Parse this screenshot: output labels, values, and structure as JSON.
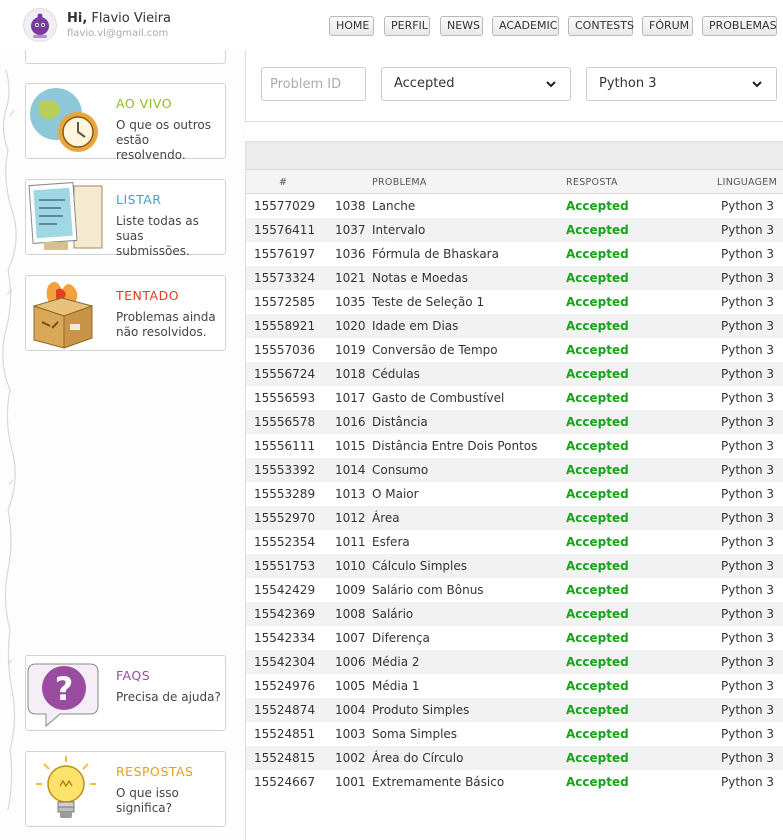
{
  "header": {
    "greeting_prefix": "Hi,",
    "user_name": "Flavio Vieira",
    "email": "flavio.vl@gmail.com",
    "nav": [
      "HOME",
      "PERFIL",
      "NEWS",
      "ACADEMIC",
      "CONTESTS",
      "FÓRUM",
      "PROBLEMAS"
    ]
  },
  "sidebar": {
    "cards": [
      {
        "title": "AO VIVO",
        "description": "O que os outros estão resolvendo.",
        "color": "#8dbd1d"
      },
      {
        "title": "LISTAR",
        "description": "Liste todas as suas submissões.",
        "color": "#3ea3c7"
      },
      {
        "title": "TENTADO",
        "description": "Problemas ainda não resolvidos.",
        "color": "#e0401d"
      },
      {
        "title": "FAQS",
        "description": "Precisa de ajuda?",
        "color": "#9a4da0"
      },
      {
        "title": "RESPOSTAS",
        "description": "O que isso significa?",
        "color": "#e8a012"
      }
    ]
  },
  "filters": {
    "problem_id_placeholder": "Problem ID",
    "answer_selected": "Accepted",
    "language_selected": "Python 3"
  },
  "table": {
    "headers": [
      "#",
      "PROBLEMA",
      "RESPOSTA",
      "LINGUAGEM"
    ],
    "rows": [
      {
        "id": "15577029",
        "pid": "1038",
        "problem": "Lanche",
        "answer": "Accepted",
        "lang": "Python 3"
      },
      {
        "id": "15576411",
        "pid": "1037",
        "problem": "Intervalo",
        "answer": "Accepted",
        "lang": "Python 3"
      },
      {
        "id": "15576197",
        "pid": "1036",
        "problem": "Fórmula de Bhaskara",
        "answer": "Accepted",
        "lang": "Python 3"
      },
      {
        "id": "15573324",
        "pid": "1021",
        "problem": "Notas e Moedas",
        "answer": "Accepted",
        "lang": "Python 3"
      },
      {
        "id": "15572585",
        "pid": "1035",
        "problem": "Teste de Seleção 1",
        "answer": "Accepted",
        "lang": "Python 3"
      },
      {
        "id": "15558921",
        "pid": "1020",
        "problem": "Idade em Dias",
        "answer": "Accepted",
        "lang": "Python 3"
      },
      {
        "id": "15557036",
        "pid": "1019",
        "problem": "Conversão de Tempo",
        "answer": "Accepted",
        "lang": "Python 3"
      },
      {
        "id": "15556724",
        "pid": "1018",
        "problem": "Cédulas",
        "answer": "Accepted",
        "lang": "Python 3"
      },
      {
        "id": "15556593",
        "pid": "1017",
        "problem": "Gasto de Combustível",
        "answer": "Accepted",
        "lang": "Python 3"
      },
      {
        "id": "15556578",
        "pid": "1016",
        "problem": "Distância",
        "answer": "Accepted",
        "lang": "Python 3"
      },
      {
        "id": "15556111",
        "pid": "1015",
        "problem": "Distância Entre Dois Pontos",
        "answer": "Accepted",
        "lang": "Python 3"
      },
      {
        "id": "15553392",
        "pid": "1014",
        "problem": "Consumo",
        "answer": "Accepted",
        "lang": "Python 3"
      },
      {
        "id": "15553289",
        "pid": "1013",
        "problem": "O Maior",
        "answer": "Accepted",
        "lang": "Python 3"
      },
      {
        "id": "15552970",
        "pid": "1012",
        "problem": "Área",
        "answer": "Accepted",
        "lang": "Python 3"
      },
      {
        "id": "15552354",
        "pid": "1011",
        "problem": "Esfera",
        "answer": "Accepted",
        "lang": "Python 3"
      },
      {
        "id": "15551753",
        "pid": "1010",
        "problem": "Cálculo Simples",
        "answer": "Accepted",
        "lang": "Python 3"
      },
      {
        "id": "15542429",
        "pid": "1009",
        "problem": "Salário com Bônus",
        "answer": "Accepted",
        "lang": "Python 3"
      },
      {
        "id": "15542369",
        "pid": "1008",
        "problem": "Salário",
        "answer": "Accepted",
        "lang": "Python 3"
      },
      {
        "id": "15542334",
        "pid": "1007",
        "problem": "Diferença",
        "answer": "Accepted",
        "lang": "Python 3"
      },
      {
        "id": "15542304",
        "pid": "1006",
        "problem": "Média 2",
        "answer": "Accepted",
        "lang": "Python 3"
      },
      {
        "id": "15524976",
        "pid": "1005",
        "problem": "Média 1",
        "answer": "Accepted",
        "lang": "Python 3"
      },
      {
        "id": "15524874",
        "pid": "1004",
        "problem": "Produto Simples",
        "answer": "Accepted",
        "lang": "Python 3"
      },
      {
        "id": "15524851",
        "pid": "1003",
        "problem": "Soma Simples",
        "answer": "Accepted",
        "lang": "Python 3"
      },
      {
        "id": "15524815",
        "pid": "1002",
        "problem": "Área do Círculo",
        "answer": "Accepted",
        "lang": "Python 3"
      },
      {
        "id": "15524667",
        "pid": "1001",
        "problem": "Extremamente Básico",
        "answer": "Accepted",
        "lang": "Python 3"
      }
    ]
  }
}
